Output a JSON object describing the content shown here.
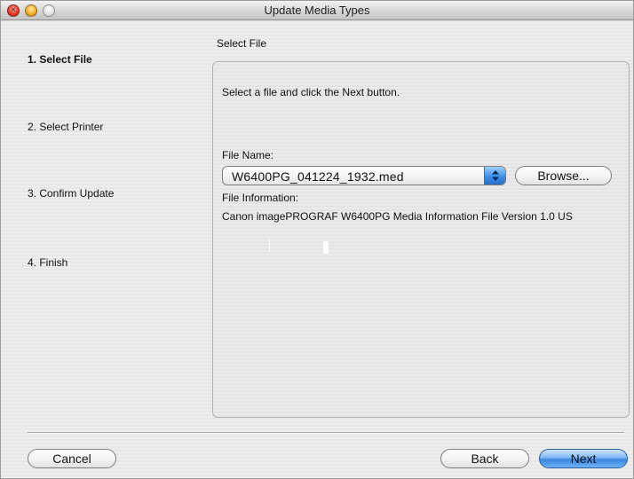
{
  "window": {
    "title": "Update Media Types"
  },
  "steps": [
    {
      "label": "1. Select File",
      "active": true
    },
    {
      "label": "2. Select Printer",
      "active": false
    },
    {
      "label": "3. Confirm Update",
      "active": false
    },
    {
      "label": "4. Finish",
      "active": false
    }
  ],
  "panel": {
    "title": "Select File",
    "instruction": "Select a file and click the Next button.",
    "file_name_label": "File Name:",
    "file_name_value": "W6400PG_041224_1932.med",
    "browse_label": "Browse...",
    "file_info_label": "File Information:",
    "file_info_value": "Canon imagePROGRAF W6400PG Media Information File Version 1.0 US"
  },
  "buttons": {
    "cancel": "Cancel",
    "back": "Back",
    "next": "Next"
  },
  "colors": {
    "default_button": "#3a86e0",
    "close": "#e23b2a",
    "minimize": "#f0b12a"
  },
  "icons": {
    "popup_arrows": "up-down-arrows-icon"
  }
}
